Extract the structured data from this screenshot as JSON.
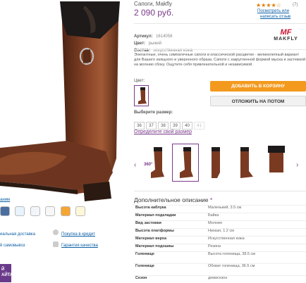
{
  "product": {
    "title": "Сапоги, Makfly",
    "price": "2 090 руб.",
    "rating_stars": "★★★★☆",
    "rating_count": "(7)",
    "review_link_1": "Посмотреть или",
    "review_link_2": "написать отзыв",
    "article_label": "Артикул:",
    "article_value": "1614058",
    "color_label": "Цвет:",
    "color_value": "рыжий",
    "material_label": "Состав:",
    "material_value": "искусственная кожа",
    "description": "Элегантные, очень симпатичные сапоги в классической расцветке - великолепный вариант для Вашего изящного и уверенного образа. Сапоги с закругленной формой мыска и застежкой на молнию сбоку. Ощутите себя привлекательной и независимой.",
    "brand_logo_mark": "MF",
    "brand_logo_text": "MAKFLY",
    "swatch_label": "Цвет:",
    "add_to_cart": "ДОБАВИТЬ В КОРЗИНУ",
    "postpone": "ОТЛОЖИТЬ НА ПОТОМ",
    "size_label": "Выберите размер:",
    "sizes": [
      "36",
      "37",
      "38",
      "39",
      "40",
      "41"
    ],
    "size_link": "Определите свой размер",
    "spin_label": "360°"
  },
  "left": {
    "share_label": "aиим",
    "link_delivery": "иальная доставка",
    "link_pickup": "й самовывоз",
    "link_credit": "Покупка в кредит",
    "link_quality": "Гарантия качества",
    "badge_line1": "Й",
    "badge_line2": "АЙТА"
  },
  "specs": {
    "title": "Дополнительное описание",
    "star": "*",
    "rows": [
      {
        "k": "Высота каблука",
        "v": "Маленький, 3.5 см"
      },
      {
        "k": "Материал подкладки",
        "v": "Байка"
      },
      {
        "k": "Вид застежки",
        "v": "Молния"
      },
      {
        "k": "Высота платформы",
        "v": "Низкая, 1.2 см"
      },
      {
        "k": "Материал верха",
        "v": "Искусственная кожа"
      },
      {
        "k": "Материал подошвы",
        "v": "Резина"
      },
      {
        "k": "Голенище",
        "v": "Высота голенища, 38.5 см"
      },
      {
        "k": "Голенище",
        "v": "Обхват голенища, 36.5 см"
      },
      {
        "k": "Сезон",
        "v": "демисезон"
      }
    ]
  },
  "colors": {
    "brand_purple": "#7a3a8a",
    "cart_orange": "#f39a1e",
    "boot_brown": "#7a3a22",
    "boot_black": "#1d1a19"
  }
}
